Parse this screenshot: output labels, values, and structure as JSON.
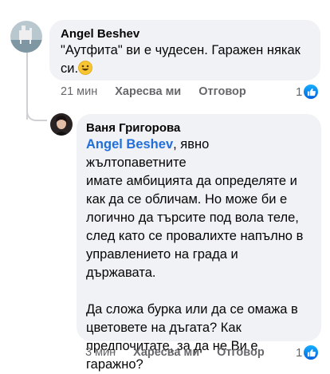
{
  "comments": [
    {
      "author": "Angel Beshev",
      "text_lines": [
        "\"Аутфита\" ви е чудесен. Гаражен някак",
        "си."
      ],
      "time": "21 мин",
      "like_label": "Харесва ми",
      "reply_label": "Отговор",
      "reaction_count": "1",
      "reaction_icon": "like-icon"
    },
    {
      "author": "Ваня Григорова",
      "mention": "Angel Beshev",
      "first_line_rest": ", явно жълтопаветните",
      "text_lines": [
        "имате амбицията да определяте и",
        "как да се обличам. Но може би е",
        "логично да търсите под вола теле,",
        "след като се провалихте напълно в",
        "управлението на града и",
        "държавата."
      ],
      "text_lines_2": [
        "Да сложа бурка или да се омажа в",
        "цветовете на дъгата? Как",
        "предпочитате, за да не Ви е",
        "гаражно?"
      ],
      "time": "3 мин",
      "like_label": "Харесва ми",
      "reply_label": "Отговор",
      "reaction_count": "1",
      "reaction_icon": "like-icon"
    }
  ],
  "colors": {
    "bubble": "#f0f2f5",
    "mention": "#216fdb",
    "meta": "#65676b"
  }
}
